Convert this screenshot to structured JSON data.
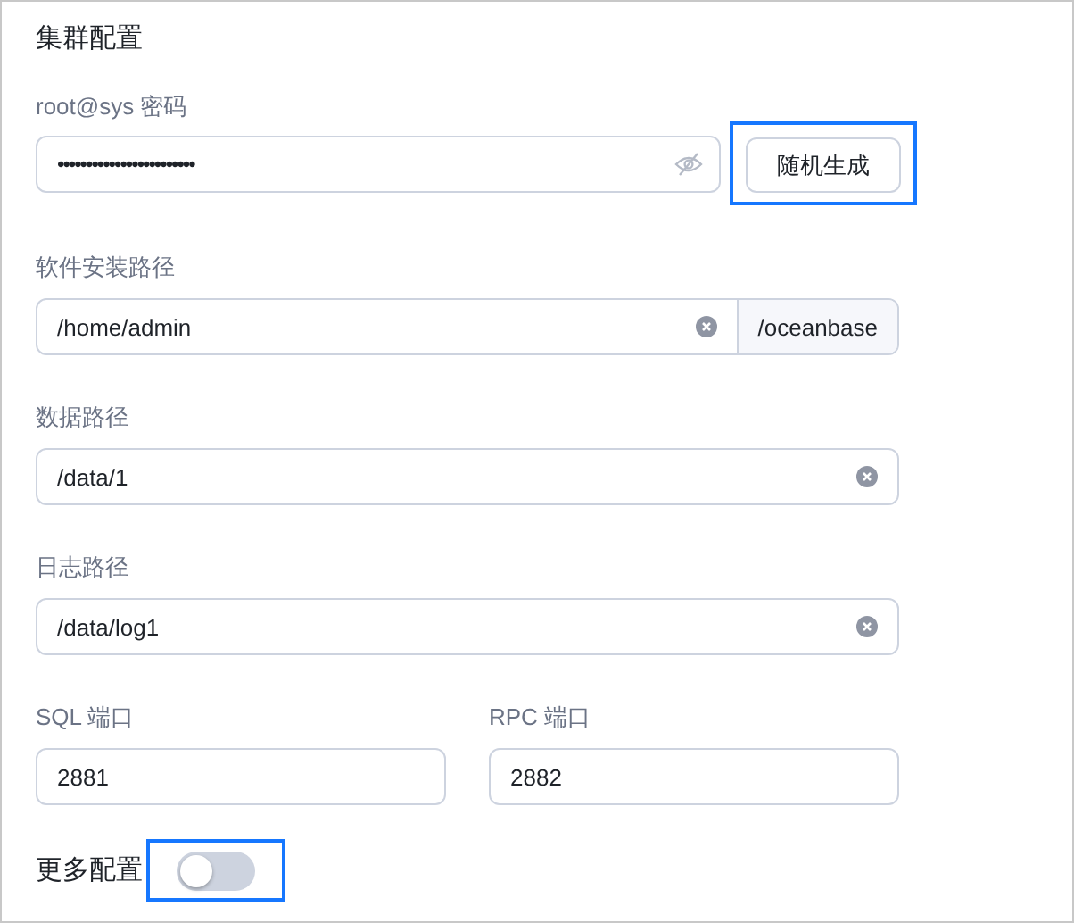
{
  "title": "集群配置",
  "password": {
    "label": "root@sys 密码",
    "value": "••••••••••••••••••••••••",
    "masked": true,
    "button": {
      "label": "随机生成",
      "framed": true
    }
  },
  "paths": [
    {
      "kind": "addon",
      "label": "软件安装路径",
      "value": "/home/admin",
      "addon": "/oceanbase"
    },
    {
      "kind": "clearable",
      "label": "数据路径",
      "value": "/data/1"
    },
    {
      "kind": "clearable",
      "label": "日志路径",
      "value": "/data/log1"
    }
  ],
  "ports": [
    {
      "label": "SQL 端口",
      "value": "2881"
    },
    {
      "label": "RPC 端口",
      "value": "2882"
    }
  ],
  "more": {
    "label": "更多配置",
    "on": false,
    "framed": true
  }
}
